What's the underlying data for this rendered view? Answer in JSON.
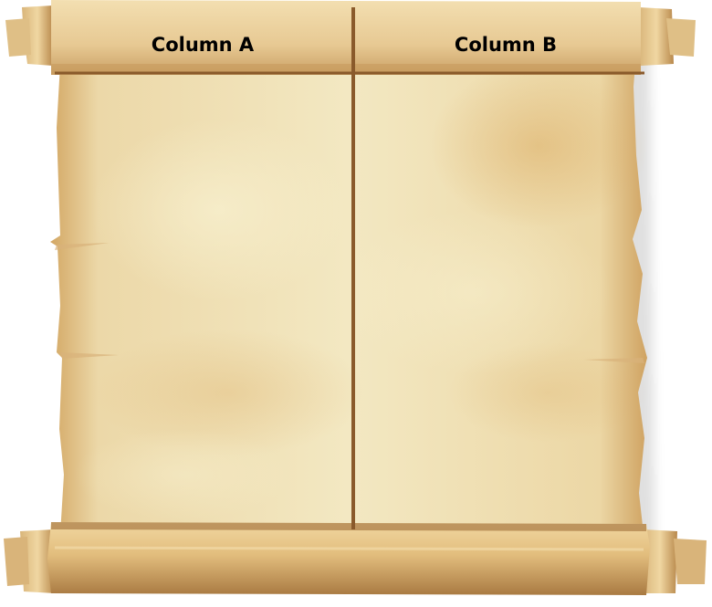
{
  "chart": {
    "type": "t-chart",
    "columns": [
      {
        "header": "Column A",
        "items": []
      },
      {
        "header": "Column B",
        "items": []
      }
    ]
  },
  "colors": {
    "parchment_light": "#f3e7bf",
    "parchment_mid": "#e9cf95",
    "parchment_dark": "#c9995a",
    "divider": "#8a5a2b",
    "header_text": "#000000"
  }
}
